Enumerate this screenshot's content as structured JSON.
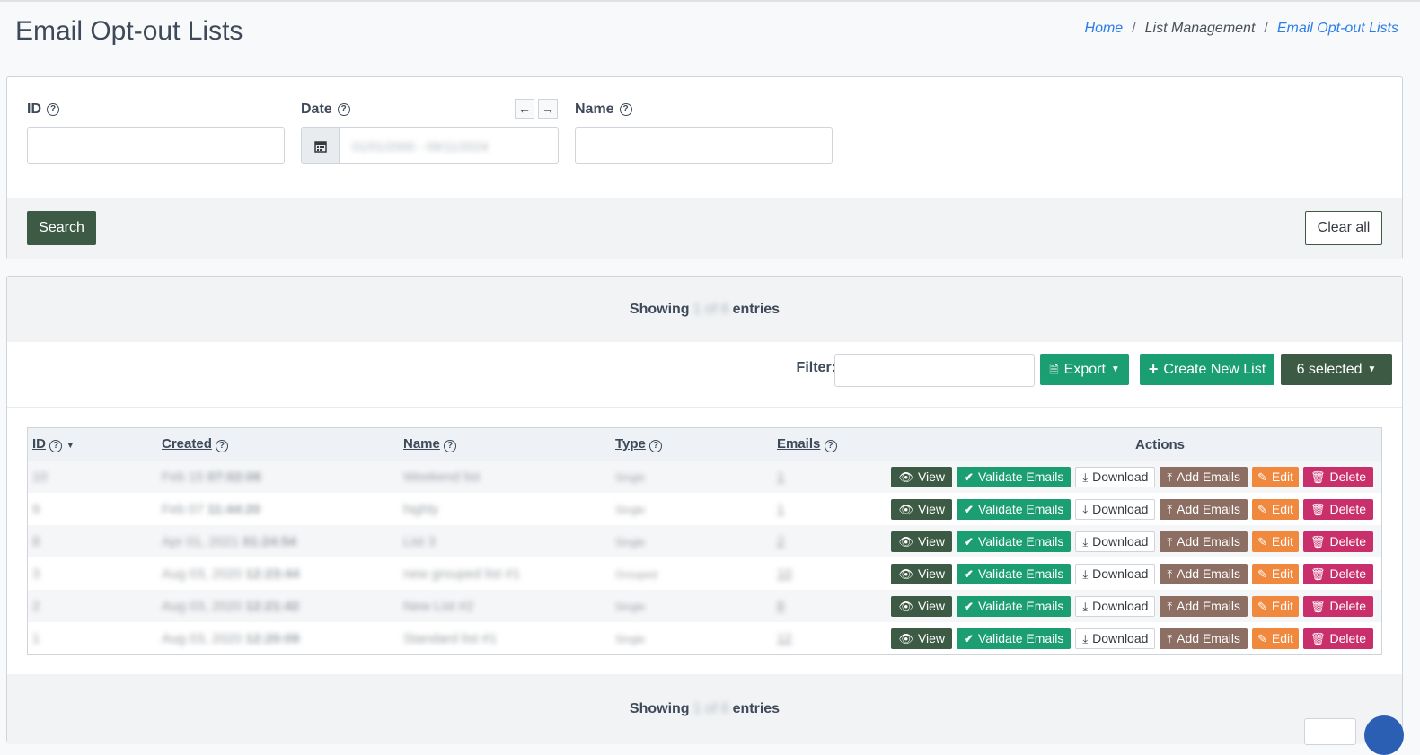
{
  "page": {
    "title": "Email Opt-out Lists",
    "breadcrumb": {
      "home": "Home",
      "sep1": "/",
      "section": "List Management",
      "sep2": "/",
      "current": "Email Opt-out Lists"
    }
  },
  "search": {
    "id_label": "ID",
    "date_label": "Date",
    "name_label": "Name",
    "date_value": "01/01/2000 - 09/11/2024",
    "prev_arrow": "←",
    "next_arrow": "→",
    "search_label": "Search",
    "clear_label": "Clear all"
  },
  "list": {
    "showing_prefix": "Showing",
    "showing_count": "1 of 6",
    "showing_suffix": "entries",
    "filter_label": "Filter:",
    "export_label": "Export",
    "create_label": "Create New List",
    "selected_label": "6 selected",
    "columns": {
      "id": "ID",
      "created": "Created",
      "name": "Name",
      "type": "Type",
      "emails": "Emails",
      "actions": "Actions"
    },
    "action_labels": {
      "view": "View",
      "validate": "Validate Emails",
      "download": "Download",
      "add": "Add Emails",
      "edit": "Edit",
      "delete": "Delete"
    },
    "rows": [
      {
        "id": "10",
        "date": "Feb 15",
        "time": "07:02:06",
        "name": "Weekend list",
        "type": "Single",
        "emails": "1"
      },
      {
        "id": "9",
        "date": "Feb 07",
        "time": "11:44:20",
        "name": "highly",
        "type": "Single",
        "emails": "1"
      },
      {
        "id": "8",
        "date": "Apr 01, 2021",
        "time": "01:24:54",
        "name": "List 3",
        "type": "Single",
        "emails": "2"
      },
      {
        "id": "3",
        "date": "Aug 03, 2020",
        "time": "12:23:44",
        "name": "new grouped list #1",
        "type": "Grouped",
        "emails": "10"
      },
      {
        "id": "2",
        "date": "Aug 03, 2020",
        "time": "12:21:42",
        "name": "New List #2",
        "type": "Single",
        "emails": "8"
      },
      {
        "id": "1",
        "date": "Aug 03, 2020",
        "time": "12:20:09",
        "name": "Standard list #1",
        "type": "Single",
        "emails": "12"
      }
    ]
  },
  "colors": {
    "primary": "#3c5a44",
    "success": "#1c9e73",
    "brown": "#8d6e63",
    "orange": "#f0883e",
    "danger": "#c9306b",
    "link": "#2b7de9"
  }
}
